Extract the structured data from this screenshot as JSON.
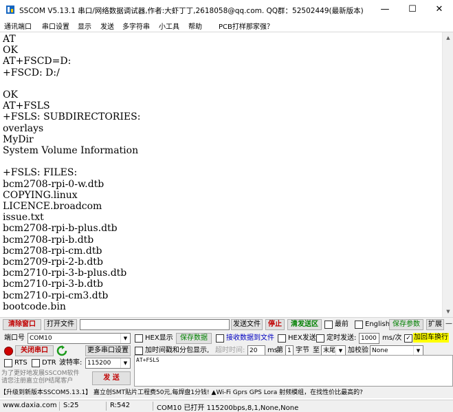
{
  "window": {
    "title": "SSCOM V5.13.1 串口/网络数据调试器,作者:大虾丁丁,2618058@qq.com. QQ群：52502449(最新版本)",
    "minimize_glyph": "—",
    "maximize_glyph": "☐",
    "close_glyph": "✕"
  },
  "menu": {
    "items": [
      "通讯端口",
      "串口设置",
      "显示",
      "发送",
      "多字符串",
      "小工具",
      "帮助",
      "PCB打样那家强？"
    ]
  },
  "terminal": {
    "lines": [
      "AT",
      "OK",
      "AT+FSCD=D:",
      "+FSCD: D:/",
      "",
      "OK",
      "AT+FSLS",
      "+FSLS: SUBDIRECTORIES:",
      "overlays",
      "MyDir",
      "System Volume Information",
      "",
      "+FSLS: FILES:",
      "bcm2708-rpi-0-w.dtb",
      "COPYING.linux",
      "LICENCE.broadcom",
      "issue.txt",
      "bcm2708-rpi-b-plus.dtb",
      "bcm2708-rpi-b.dtb",
      "bcm2708-rpi-cm.dtb",
      "bcm2709-rpi-2-b.dtb",
      "bcm2710-rpi-3-b-plus.dtb",
      "bcm2710-rpi-3-b.dtb",
      "bcm2710-rpi-cm3.dtb",
      "bootcode.bin"
    ]
  },
  "toolbar": {
    "clear_window": "清除窗口",
    "open_file": "打开文件",
    "send_file": "发送文件",
    "stop": "停止",
    "clear_send_area": "清发送区",
    "topmost": "最前",
    "english": "English",
    "save_params": "保存参数",
    "expand": "扩展",
    "collapse": "—"
  },
  "port": {
    "label": "端口号",
    "value": "COM10",
    "hex_display": "HEX显示",
    "save_data": "保存数据",
    "recv_to_file": "接收数据到文件",
    "hex_send": "HEX发送",
    "timed_send": "定时发送:",
    "interval": "1000",
    "interval_unit": "ms/次",
    "add_crlf_checked": "✓",
    "add_crlf": "加回车换行",
    "close_port": "关闭串口",
    "more_settings": "更多串口设置",
    "timestamp_split": "加时间戳和分包显示,",
    "timeout_label": "超时时间:",
    "timeout": "20",
    "timeout_unit": "ms",
    "byte_no_prefix": "第",
    "byte_no": "1",
    "byte_unit": "字节",
    "to_label": "至",
    "to_value": "末尾",
    "checksum_label": "加校验",
    "checksum_value": "None",
    "rts": "RTS",
    "dtr": "DTR",
    "baud_label": "波特率:",
    "baud": "115200"
  },
  "send": {
    "text": "AT+FSLS",
    "button": "发 送",
    "promo_text": "为了更好地发展SSCOM软件\n请您注册嘉立创P结尾客户"
  },
  "promo_bar": {
    "text": "【升级到新版本SSCOM5.13.1】    嘉立创SMT贴片工程费50元,每焊盘1分钱! ▲Wi-Fi Gprs GPS Lora 射频模组，在找性价比最高的?"
  },
  "status": {
    "site": "www.daxia.com",
    "sent": "S:25",
    "received": "R:542",
    "port_status": "COM10 已打开  115200bps,8,1,None,None"
  },
  "colors": {
    "red_button_text": "#c00000",
    "yellow_highlight": "#ffff00",
    "green_text": "#008000",
    "blue_text": "#0000c0",
    "accent_icon": "#1565c0"
  }
}
